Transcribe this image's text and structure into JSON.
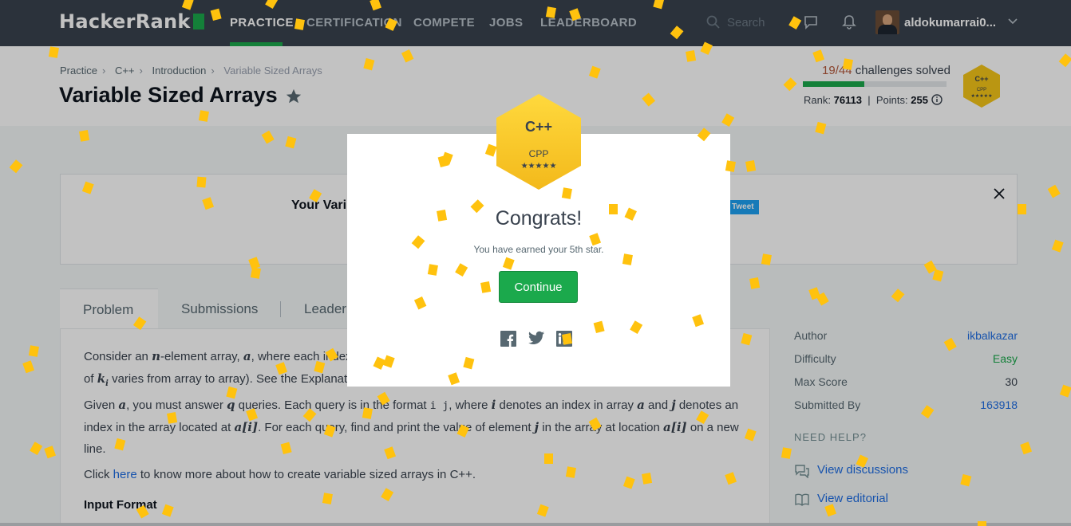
{
  "nav": {
    "logo": "HackerRank",
    "links": [
      "PRACTICE",
      "CERTIFICATION",
      "COMPETE",
      "JOBS",
      "LEADERBOARD"
    ],
    "active": "PRACTICE",
    "search_placeholder": "Search",
    "username": "aldokumarrai0..."
  },
  "breadcrumb": [
    "Practice",
    "C++",
    "Introduction",
    "Variable Sized Arrays"
  ],
  "title": "Variable Sized Arrays",
  "progress": {
    "solved": "19",
    "total": "44",
    "label": "challenges solved",
    "fraction": 0.43,
    "rank_label": "Rank:",
    "rank": "76113",
    "points_label": "Points:",
    "points": "255"
  },
  "badge": {
    "name": "C++",
    "sub": "CPP",
    "stars": "★★★★★"
  },
  "banner": {
    "text": "Your Vari",
    "tweet": "Tweet"
  },
  "tabs": [
    "Problem",
    "Submissions",
    "Leaderb"
  ],
  "problem": {
    "p1a": "Consider an ",
    "p1n": "n",
    "p1b": "-element array, ",
    "p1c": "a",
    "p1d": ", where each index s",
    "p1e": "ue",
    "p2a": "of ",
    "p2k": "k",
    "p2i": "i",
    "p2b": " varies from array to array). See the Explanatio",
    "p3a": "Given ",
    "p3b": "a",
    "p3c": ", you must answer ",
    "p3q": "q",
    "p3d": " queries. Each query is in the format ",
    "p3code": "i j",
    "p3e": ", where ",
    "p3i": "i",
    "p3f": " denotes an index in array ",
    "p3g": "a",
    "p3h": " and ",
    "p3j": "j",
    "p3k": " denotes an",
    "p4a": "index in the array located at ",
    "p4m": "a[i]",
    "p4b": ". For each query, find and print the value of element ",
    "p4j": "j",
    "p4c": " in the array at location ",
    "p4m2": "a[i]",
    "p4d": " on a new",
    "p5": "line.",
    "p6a": "Click ",
    "p6link": "here",
    "p6b": " to know more about how to create variable sized arrays in C++.",
    "input_format": "Input Format"
  },
  "sidebar": {
    "author_label": "Author",
    "author": "ikbalkazar",
    "difficulty_label": "Difficulty",
    "difficulty": "Easy",
    "maxscore_label": "Max Score",
    "maxscore": "30",
    "submitted_label": "Submitted By",
    "submitted": "163918",
    "needhelp": "NEED HELP?",
    "discussions": "View discussions",
    "editorial": "View editorial"
  },
  "modal": {
    "title": "Congrats!",
    "message": "You have earned your 5th star.",
    "continue": "Continue"
  },
  "colors": {
    "nav_bg": "#39424e",
    "accent_green": "#1ba94c",
    "badge_gold": "#f5c518",
    "link_blue": "#1f6ee4",
    "confetti": "#ffc20e"
  },
  "icons": [
    "search-icon",
    "chat-icon",
    "bell-icon",
    "chevron-down-icon",
    "star-icon",
    "info-icon",
    "close-icon",
    "facebook-icon",
    "twitter-icon",
    "linkedin-icon",
    "discussions-icon",
    "book-icon"
  ]
}
